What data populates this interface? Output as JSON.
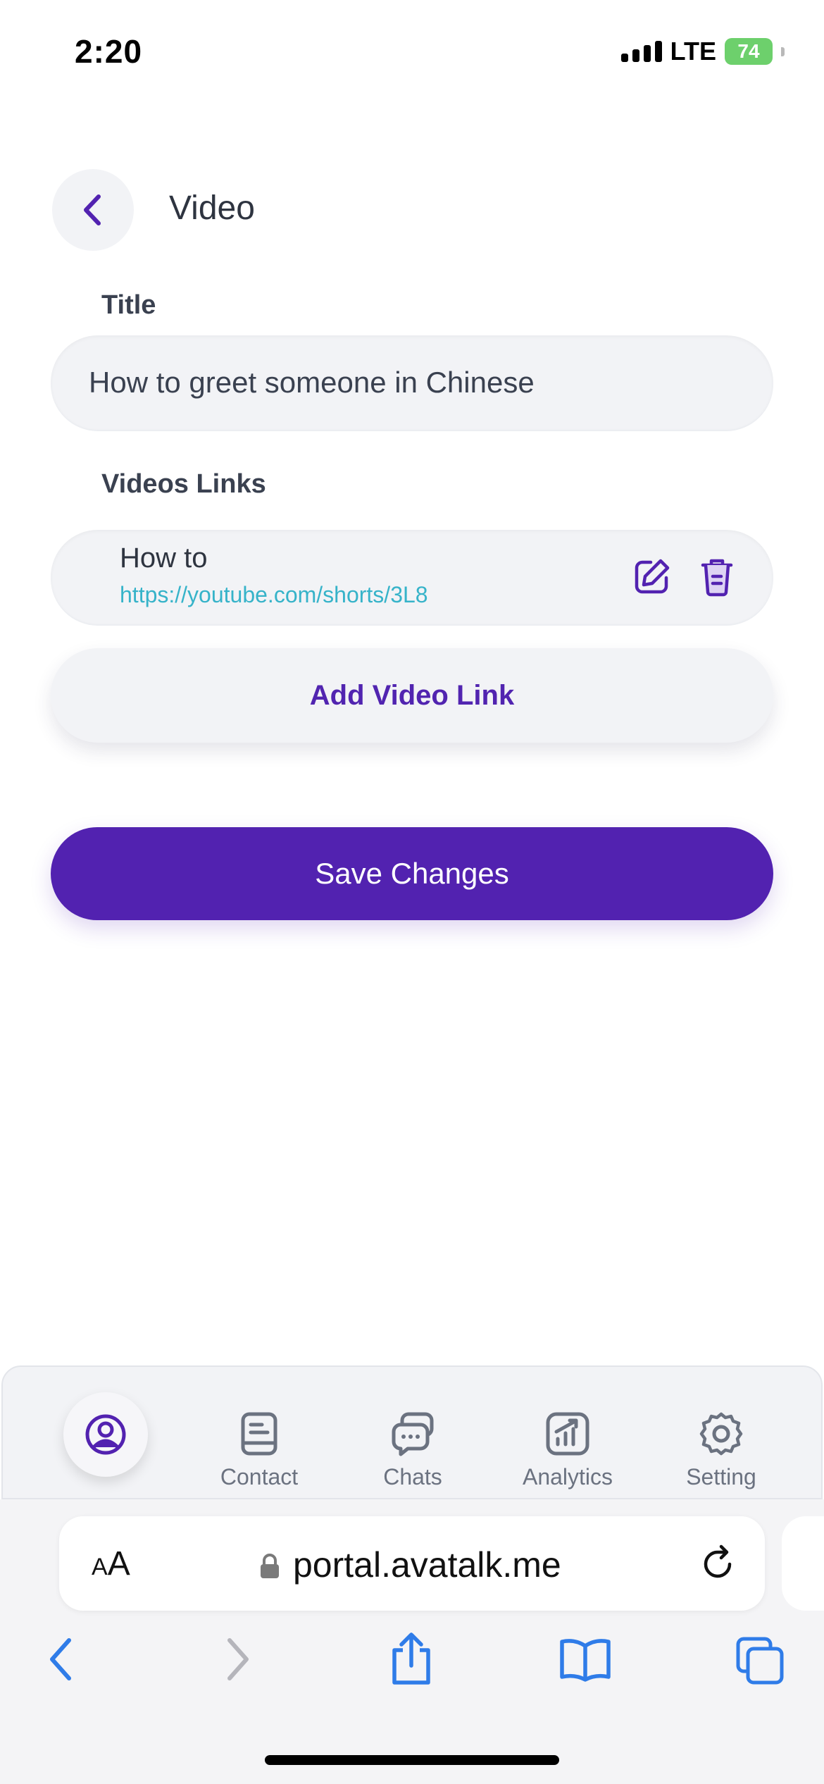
{
  "status_bar": {
    "time": "2:20",
    "network": "LTE",
    "battery": "74"
  },
  "header": {
    "title": "Video"
  },
  "form": {
    "title_label": "Title",
    "title_value": "How to greet someone in Chinese",
    "links_label": "Videos Links",
    "links": [
      {
        "name": "How to",
        "url": "https://youtube.com/shorts/3L8"
      }
    ],
    "add_button": "Add Video Link",
    "save_button": "Save Changes"
  },
  "bottom_nav": {
    "items": [
      {
        "label": "Contact"
      },
      {
        "label": "Chats"
      },
      {
        "label": "Analytics"
      },
      {
        "label": "Setting"
      }
    ]
  },
  "browser": {
    "text_size": "AA",
    "url": "portal.avatalk.me"
  },
  "colors": {
    "accent": "#5222b0",
    "link": "#36b3c9",
    "field_bg": "#f2f3f6"
  }
}
